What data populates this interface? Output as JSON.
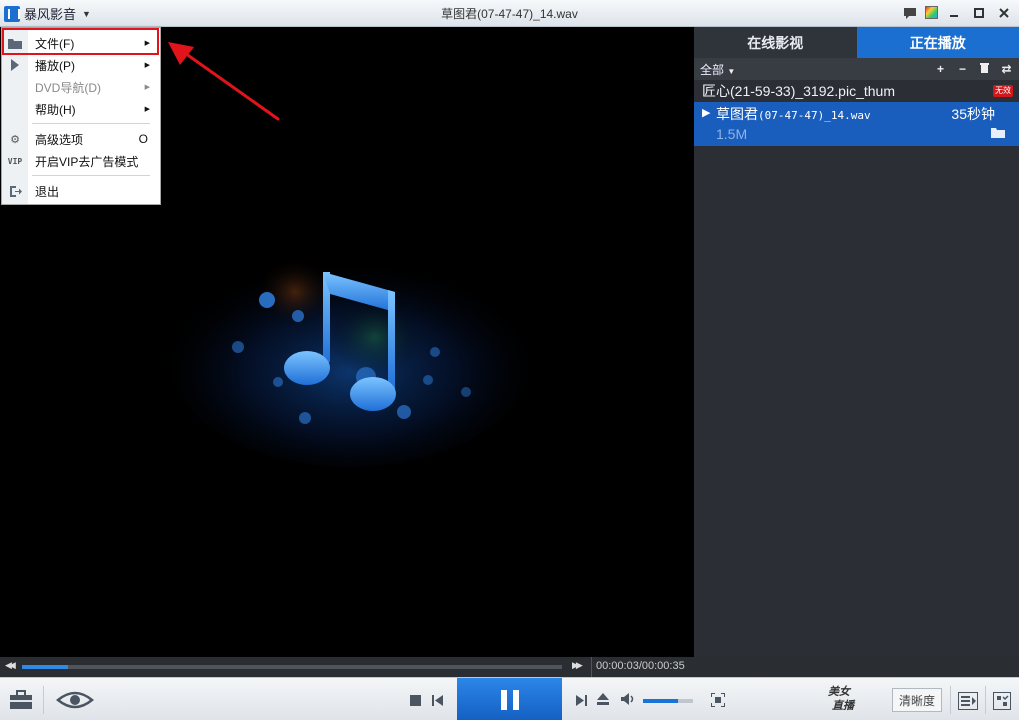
{
  "app": {
    "name": "暴风影音",
    "window_title": "草图君(07-47-47)_14.wav"
  },
  "menu": {
    "items": [
      {
        "label": "文件(F)",
        "has_submenu": true,
        "icon": "folder-icon"
      },
      {
        "label": "播放(P)",
        "has_submenu": true,
        "icon": "play-icon"
      },
      {
        "label": "DVD导航(D)",
        "has_submenu": true,
        "disabled": true
      },
      {
        "label": "帮助(H)",
        "has_submenu": true
      },
      {
        "label": "高级选项",
        "accelerator": "O",
        "icon": "gear-icon"
      },
      {
        "label": "开启VIP去广告模式",
        "icon": "vip-icon"
      },
      {
        "label": "退出",
        "icon": "exit-icon"
      }
    ],
    "highlighted_item": "文件(F)"
  },
  "panel": {
    "tabs": [
      {
        "label": "在线影视",
        "active": false
      },
      {
        "label": "正在播放",
        "active": true
      }
    ],
    "filter": "全部",
    "playlist": [
      {
        "name": "匠心(21-59-33)_3192.pic_thum",
        "badge": "无效"
      },
      {
        "name_prefix": "草图君",
        "name_suffix": "(07-47-47)_14.wav",
        "duration": "35秒钟",
        "size": "1.5M",
        "playing": true
      }
    ]
  },
  "playback": {
    "time": "00:00:03/00:00:35",
    "progress": 0.086,
    "volume": 0.7
  },
  "controls": {
    "quality": "清晰度",
    "live_badge_line1": "美女",
    "live_badge_line2": "直播"
  },
  "colors": {
    "accent": "#1a6fd1",
    "annotation_red": "#e1141b",
    "panel_bg": "#2b2f35"
  }
}
